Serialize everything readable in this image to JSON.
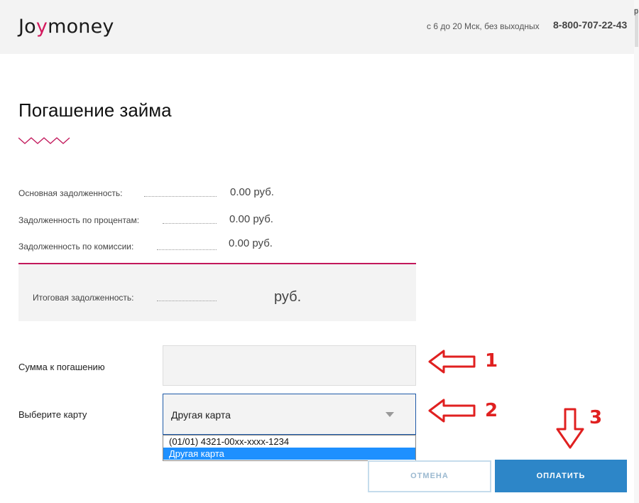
{
  "header": {
    "logo_text": "Joymoney",
    "logo_parts": {
      "start": "Jo",
      "end": "money"
    },
    "hours": "с 6 до 20 Мск, без выходных",
    "phone": "8-800-707-22-43",
    "brand_colors": {
      "pink": "#d31a5e",
      "blue": "#1e5aa8"
    }
  },
  "page": {
    "title": "Погашение займа"
  },
  "debts": [
    {
      "label": "Основная задолженность:",
      "value": "0.00 руб."
    },
    {
      "label": "Задолженность по процентам:",
      "value": "0.00 руб."
    },
    {
      "label": "Задолженность по комиссии:",
      "value": "0.00 руб."
    }
  ],
  "total": {
    "label": "Итоговая задолженность:",
    "value": "руб."
  },
  "form": {
    "amount_label": "Сумма к погашению",
    "amount_value": "",
    "card_label": "Выберите карту",
    "card_selected": "Другая карта",
    "card_options": [
      "(01/01) 4321-00xx-xxxx-1234",
      "Другая карта"
    ]
  },
  "buttons": {
    "cancel": "ОТМЕНА",
    "pay": "ОПЛАТИТЬ"
  },
  "annotations": [
    "1",
    "2",
    "3"
  ],
  "colors": {
    "accent": "#c2185b",
    "pay_button": "#2d86c8",
    "arrow": "#e02020",
    "dropdown_highlight": "#1e90ff"
  },
  "scrollbar_char": "р"
}
